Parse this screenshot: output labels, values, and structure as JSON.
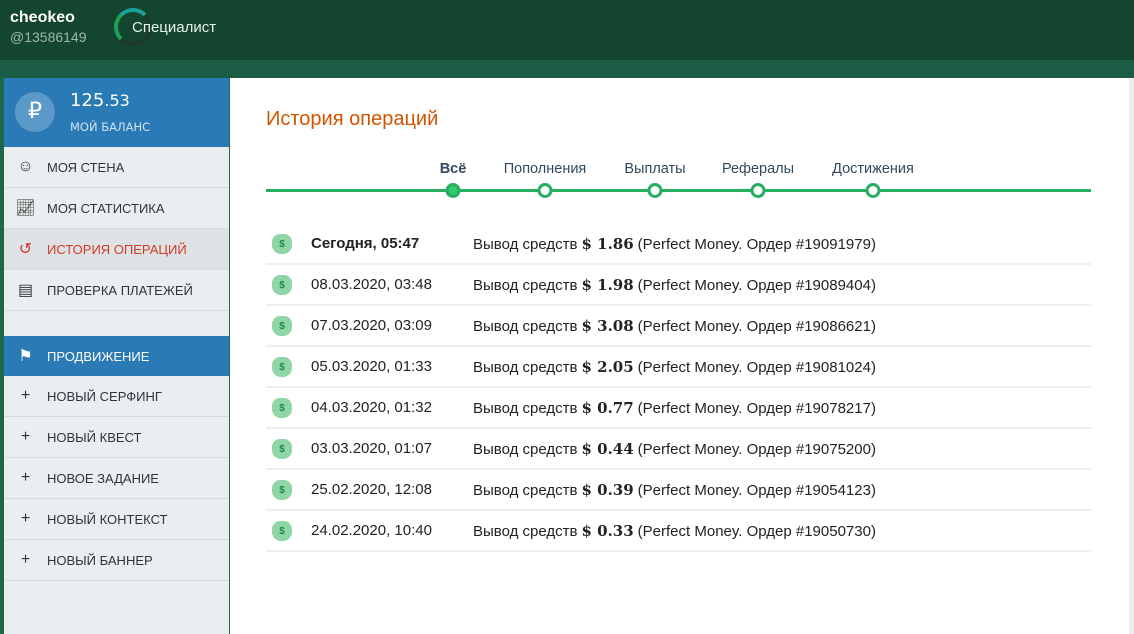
{
  "header": {
    "username": "cheokeo",
    "user_id": "@13586149",
    "level": "Специалист"
  },
  "balance": {
    "symbol": "₽",
    "integer": "125",
    "fraction": ".53",
    "label": "МОЙ БАЛАНС"
  },
  "sidebar": {
    "items": [
      {
        "label": "МОЯ СТЕНА",
        "icon": "user-hat-icon"
      },
      {
        "label": "МОЯ СТАТИСТИКА",
        "icon": "chart-line-icon"
      },
      {
        "label": "ИСТОРИЯ ОПЕРАЦИЙ",
        "icon": "history-icon",
        "active": true
      },
      {
        "label": "ПРОВЕРКА ПЛАТЕЖЕЙ",
        "icon": "clipboard-icon"
      }
    ],
    "promo_label": "ПРОДВИЖЕНИЕ",
    "promo_items": [
      {
        "label": "НОВЫЙ СЕРФИНГ"
      },
      {
        "label": "НОВЫЙ КВЕСТ"
      },
      {
        "label": "НОВОЕ ЗАДАНИЕ"
      },
      {
        "label": "НОВЫЙ КОНТЕКСТ"
      },
      {
        "label": "НОВЫЙ БАННЕР"
      }
    ]
  },
  "main": {
    "title": "История операций",
    "tabs": [
      {
        "label": "Всё"
      },
      {
        "label": "Пополнения"
      },
      {
        "label": "Выплаты"
      },
      {
        "label": "Рефералы"
      },
      {
        "label": "Достижения"
      }
    ],
    "rows": [
      {
        "date": "Сегодня, 05:47",
        "prefix": "Вывод средств",
        "amount": "$ 1.86",
        "details": "(Perfect Money. Ордер #19091979)"
      },
      {
        "date": "08.03.2020, 03:48",
        "prefix": "Вывод средств",
        "amount": "$ 1.98",
        "details": "(Perfect Money. Ордер #19089404)"
      },
      {
        "date": "07.03.2020, 03:09",
        "prefix": "Вывод средств",
        "amount": "$ 3.08",
        "details": "(Perfect Money. Ордер #19086621)"
      },
      {
        "date": "05.03.2020, 01:33",
        "prefix": "Вывод средств",
        "amount": "$ 2.05",
        "details": "(Perfect Money. Ордер #19081024)"
      },
      {
        "date": "04.03.2020, 01:32",
        "prefix": "Вывод средств",
        "amount": "$ 0.77",
        "details": "(Perfect Money. Ордер #19078217)"
      },
      {
        "date": "03.03.2020, 01:07",
        "prefix": "Вывод средств",
        "amount": "$ 0.44",
        "details": "(Perfect Money. Ордер #19075200)"
      },
      {
        "date": "25.02.2020, 12:08",
        "prefix": "Вывод средств",
        "amount": "$ 0.39",
        "details": "(Perfect Money. Ордер #19054123)"
      },
      {
        "date": "24.02.2020, 10:40",
        "prefix": "Вывод средств",
        "amount": "$ 0.33",
        "details": "(Perfect Money. Ордер #19050730)"
      }
    ]
  }
}
